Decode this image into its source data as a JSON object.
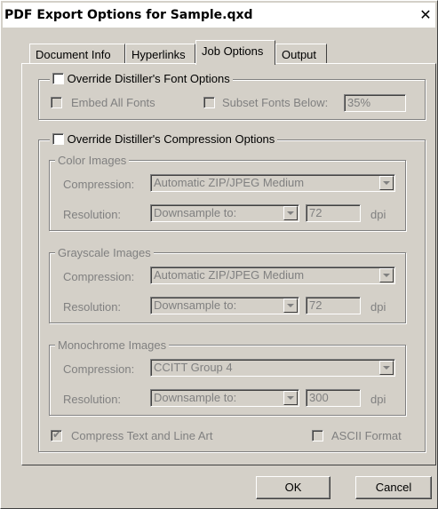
{
  "window": {
    "title": "PDF Export Options for Sample.qxd",
    "close_glyph": "✕"
  },
  "tabs": [
    {
      "label": "Document Info",
      "active": false
    },
    {
      "label": "Hyperlinks",
      "active": false
    },
    {
      "label": "Job Options",
      "active": true
    },
    {
      "label": "Output",
      "active": false
    }
  ],
  "font_options": {
    "override_label": "Override Distiller's Font Options",
    "override_checked": false,
    "embed_all_label": "Embed All Fonts",
    "embed_all_checked": false,
    "subset_label": "Subset Fonts Below:",
    "subset_checked": false,
    "subset_value": "35%"
  },
  "compression_options": {
    "override_label": "Override Distiller's Compression Options",
    "override_checked": false,
    "color": {
      "title": "Color Images",
      "compression_label": "Compression:",
      "compression_value": "Automatic ZIP/JPEG Medium",
      "resolution_label": "Resolution:",
      "resolution_value": "Downsample to:",
      "dpi_value": "72",
      "dpi_label": "dpi"
    },
    "grayscale": {
      "title": "Grayscale Images",
      "compression_label": "Compression:",
      "compression_value": "Automatic ZIP/JPEG Medium",
      "resolution_label": "Resolution:",
      "resolution_value": "Downsample to:",
      "dpi_value": "72",
      "dpi_label": "dpi"
    },
    "monochrome": {
      "title": "Monochrome Images",
      "compression_label": "Compression:",
      "compression_value": "CCITT Group 4",
      "resolution_label": "Resolution:",
      "resolution_value": "Downsample to:",
      "dpi_value": "300",
      "dpi_label": "dpi"
    },
    "compress_text_label": "Compress Text and Line Art",
    "compress_text_checked": true,
    "ascii_label": "ASCII Format",
    "ascii_checked": false
  },
  "buttons": {
    "ok": "OK",
    "cancel": "Cancel"
  },
  "glyphs": {
    "check": "✔"
  }
}
